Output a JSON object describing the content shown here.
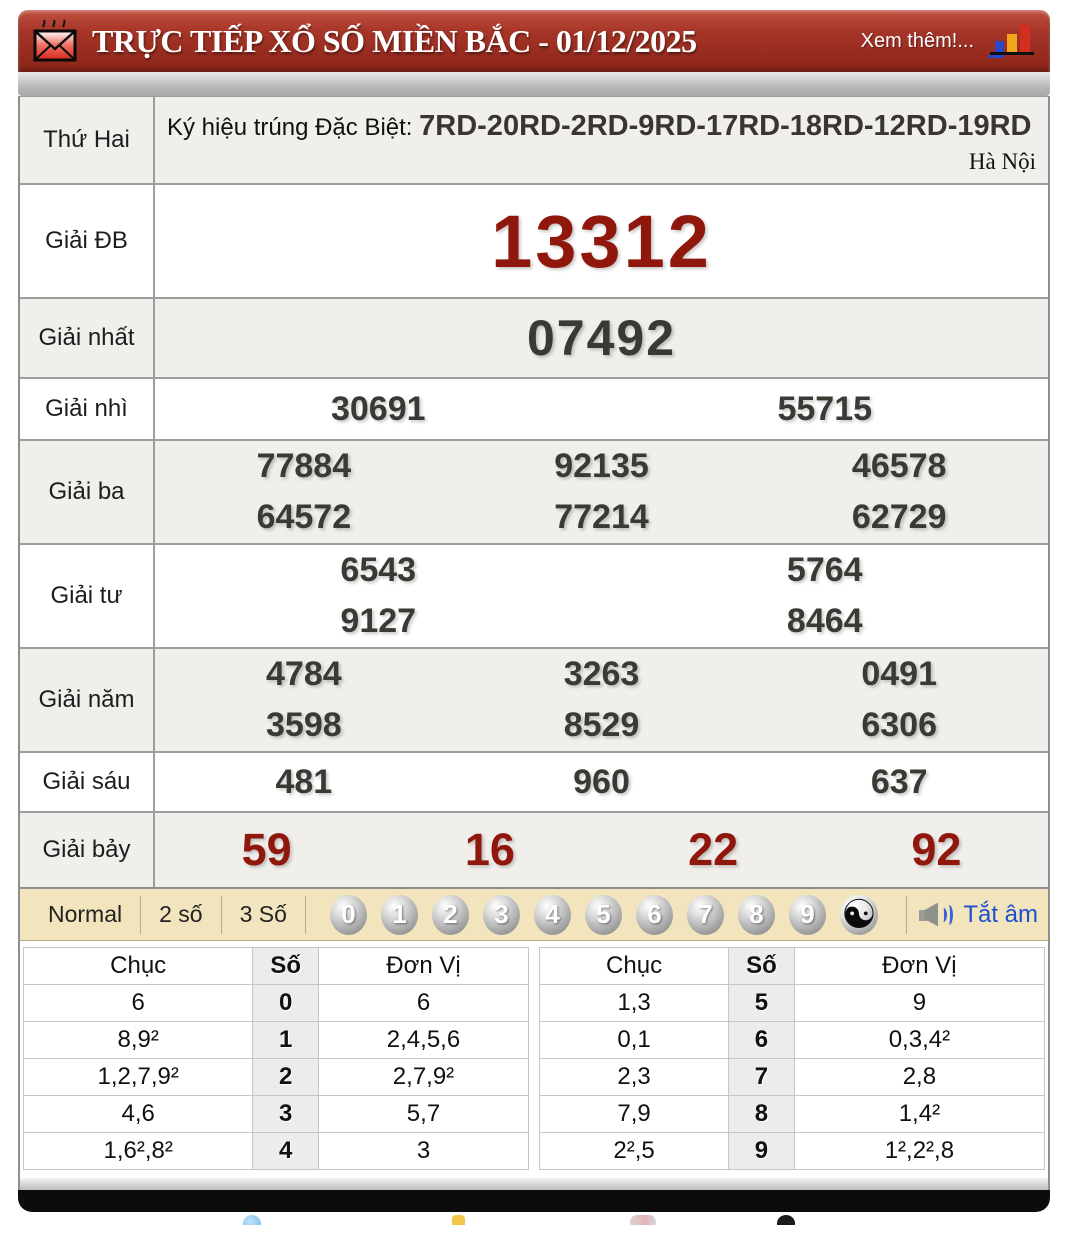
{
  "header": {
    "title": "TRỰC TIẾP XỔ SỐ MIỀN BẮC - 01/12/2025",
    "more_link": "Xem thêm!..."
  },
  "info_row": {
    "day": "Thứ Hai",
    "symbol_label": "Ký hiệu trúng Đặc Biệt:",
    "symbol_codes": "7RD-20RD-2RD-9RD-17RD-18RD-12RD-19RD",
    "region": "Hà Nội"
  },
  "prizes": [
    {
      "id": "db",
      "label": "Giải ĐB",
      "rows": [
        [
          "13312"
        ]
      ]
    },
    {
      "id": "first",
      "label": "Giải nhất",
      "rows": [
        [
          "07492"
        ]
      ]
    },
    {
      "id": "second",
      "label": "Giải nhì",
      "rows": [
        [
          "30691",
          "55715"
        ]
      ]
    },
    {
      "id": "third",
      "label": "Giải ba",
      "rows": [
        [
          "77884",
          "92135",
          "46578"
        ],
        [
          "64572",
          "77214",
          "62729"
        ]
      ]
    },
    {
      "id": "fourth",
      "label": "Giải tư",
      "rows": [
        [
          "6543",
          "5764"
        ],
        [
          "9127",
          "8464"
        ]
      ]
    },
    {
      "id": "fifth",
      "label": "Giải năm",
      "rows": [
        [
          "4784",
          "3263",
          "0491"
        ],
        [
          "3598",
          "8529",
          "6306"
        ]
      ]
    },
    {
      "id": "sixth",
      "label": "Giải sáu",
      "rows": [
        [
          "481",
          "960",
          "637"
        ]
      ]
    },
    {
      "id": "seventh",
      "label": "Giải bảy",
      "rows": [
        [
          "59",
          "16",
          "22",
          "92"
        ]
      ]
    }
  ],
  "toolbar": {
    "modes": [
      "Normal",
      "2 số",
      "3 Số"
    ],
    "balls": [
      "0",
      "1",
      "2",
      "3",
      "4",
      "5",
      "6",
      "7",
      "8",
      "9"
    ],
    "yinyang": "☯",
    "mute_label": "Tắt âm"
  },
  "stats": {
    "headers": [
      "Chục",
      "Số",
      "Đơn Vị"
    ],
    "left_table": [
      {
        "chuc": "6",
        "so": "0",
        "donvi": "6"
      },
      {
        "chuc": "8,9²",
        "so": "1",
        "donvi": "2,4,5,6"
      },
      {
        "chuc": "1,2,7,9²",
        "so": "2",
        "donvi": "2,7,9²"
      },
      {
        "chuc": "4,6",
        "so": "3",
        "donvi": "5,7"
      },
      {
        "chuc": "1,6²,8²",
        "so": "4",
        "donvi": "3"
      }
    ],
    "right_table": [
      {
        "chuc": "1,3",
        "so": "5",
        "donvi": "9"
      },
      {
        "chuc": "0,1",
        "so": "6",
        "donvi": "0,3,4²"
      },
      {
        "chuc": "2,3",
        "so": "7",
        "donvi": "2,8"
      },
      {
        "chuc": "7,9",
        "so": "8",
        "donvi": "1,4²"
      },
      {
        "chuc": "2²,5",
        "so": "9",
        "donvi": "1²,2²,8"
      }
    ]
  },
  "colors": {
    "header_red": "#9e2f23",
    "number_red": "#8f170c",
    "number_dark": "#3a3933",
    "toolbar_bg": "#f2e4bc",
    "link_blue": "#1c4fd1"
  }
}
